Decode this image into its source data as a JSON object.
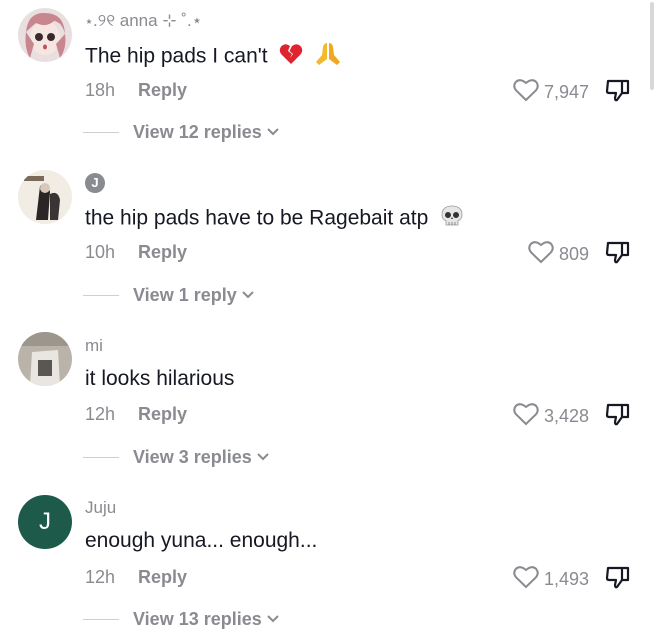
{
  "comments": [
    {
      "username": "⋆.୨୧ anna ⊹ ˚.⋆",
      "text": "The hip pads I can't",
      "emojis": [
        "broken-heart-icon",
        "praying-hands-icon"
      ],
      "time": "18h",
      "reply_label": "Reply",
      "likes": "7,947",
      "view_replies": "View 12 replies"
    },
    {
      "username": "J",
      "text": "the hip pads have to be Ragebait atp",
      "emojis": [
        "skull-icon"
      ],
      "time": "10h",
      "reply_label": "Reply",
      "likes": "809",
      "view_replies": "View 1 reply"
    },
    {
      "username": "mi",
      "text": "it looks hilarious",
      "emojis": [],
      "time": "12h",
      "reply_label": "Reply",
      "likes": "3,428",
      "view_replies": "View 3 replies"
    },
    {
      "username": "Juju",
      "avatar_letter": "J",
      "text": "enough yuna... enough...",
      "emojis": [],
      "time": "12h",
      "reply_label": "Reply",
      "likes": "1,493",
      "view_replies": "View 13 replies"
    }
  ],
  "colors": {
    "text": "#161823",
    "secondary": "#8a8b91",
    "juju_avatar": "#1e5a4a"
  }
}
